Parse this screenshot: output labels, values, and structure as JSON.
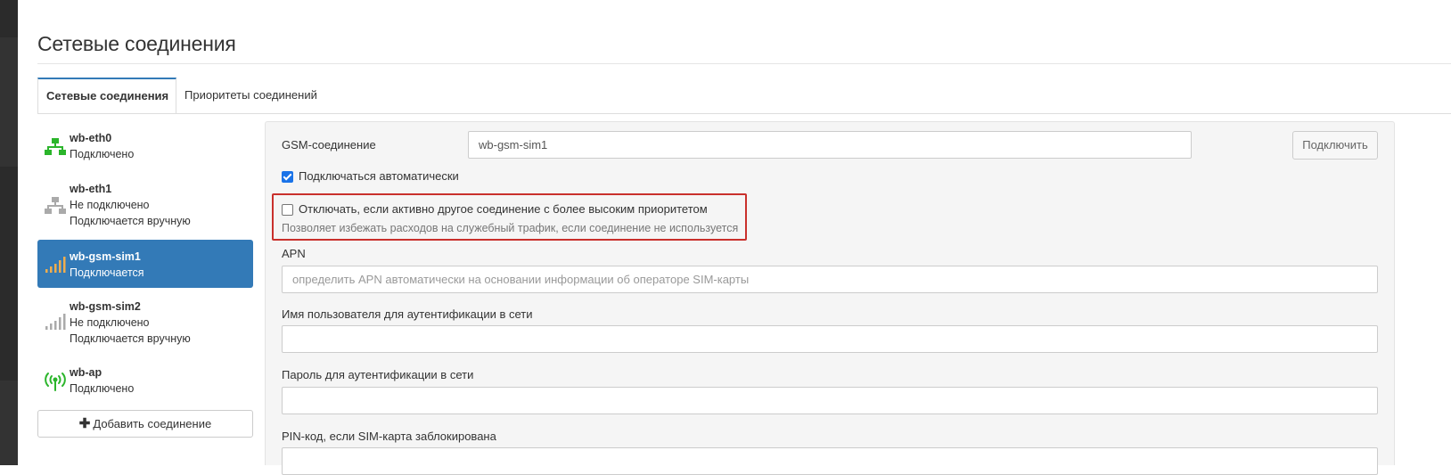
{
  "page": {
    "title": "Сетевые соединения"
  },
  "tabs": [
    {
      "label": "Сетевые соединения",
      "active": true
    },
    {
      "label": "Приоритеты соединений",
      "active": false
    }
  ],
  "connections": [
    {
      "name": "wb-eth0",
      "status": "Подключено",
      "extra": "",
      "icon": "ethernet-icon",
      "icon_color": "#2bb52b",
      "selected": false
    },
    {
      "name": "wb-eth1",
      "status": "Не подключено",
      "extra": "Подключается вручную",
      "icon": "ethernet-icon",
      "icon_color": "#aaaaaa",
      "selected": false
    },
    {
      "name": "wb-gsm-sim1",
      "status": "Подключается",
      "extra": "",
      "icon": "signal-bars-icon",
      "icon_color": "#f0ad4e",
      "selected": true
    },
    {
      "name": "wb-gsm-sim2",
      "status": "Не подключено",
      "extra": "Подключается вручную",
      "icon": "signal-bars-icon",
      "icon_color": "#aaaaaa",
      "selected": false
    },
    {
      "name": "wb-ap",
      "status": "Подключено",
      "extra": "",
      "icon": "wifi-antenna-icon",
      "icon_color": "#2bb52b",
      "selected": false
    }
  ],
  "add_button": {
    "icon": "plus-icon",
    "label": "Добавить соединение"
  },
  "form": {
    "gsm_label": "GSM-соединение",
    "gsm_value": "wb-gsm-sim1",
    "connect_button": "Подключить",
    "auto_connect_label": "Подключаться автоматически",
    "auto_connect_checked": true,
    "disconnect_label": "Отключать, если активно другое соединение с более высоким приоритетом",
    "disconnect_checked": false,
    "disconnect_help": "Позволяет избежать расходов на служебный трафик, если соединение не используется",
    "apn_label": "APN",
    "apn_placeholder": "определить APN автоматически на основании информации об операторе SIM-карты",
    "user_label": "Имя пользователя для аутентификации в сети",
    "user_value": "",
    "password_label": "Пароль для аутентификации в сети",
    "password_value": "",
    "pin_label": "PIN-код, если SIM-карта заблокирована"
  },
  "colors": {
    "accent": "#337ab7",
    "highlight": "#c9302c",
    "connected": "#2bb52b",
    "connecting": "#f0ad4e",
    "inactive": "#aaaaaa"
  }
}
